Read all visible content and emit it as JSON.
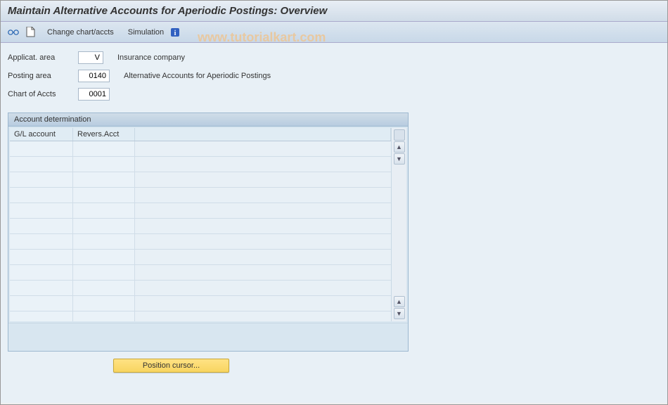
{
  "header": {
    "title": "Maintain Alternative Accounts for Aperiodic Postings: Overview"
  },
  "toolbar": {
    "change_chart_label": "Change chart/accts",
    "simulation_label": "Simulation"
  },
  "form": {
    "fields": [
      {
        "label": "Applicat. area",
        "value": "V",
        "desc": "Insurance company",
        "width": "narrow"
      },
      {
        "label": "Posting area",
        "value": "0140",
        "desc": "Alternative Accounts for Aperiodic Postings",
        "width": "medium"
      },
      {
        "label": "Chart of Accts",
        "value": "0001",
        "desc": "",
        "width": "medium"
      }
    ]
  },
  "panel": {
    "title": "Account determination",
    "columns": [
      {
        "label": "G/L account"
      },
      {
        "label": "Revers.Acct"
      }
    ],
    "rows_count": 12
  },
  "footer": {
    "button_label": "Position cursor..."
  },
  "watermark": "www.tutorialkart.com"
}
